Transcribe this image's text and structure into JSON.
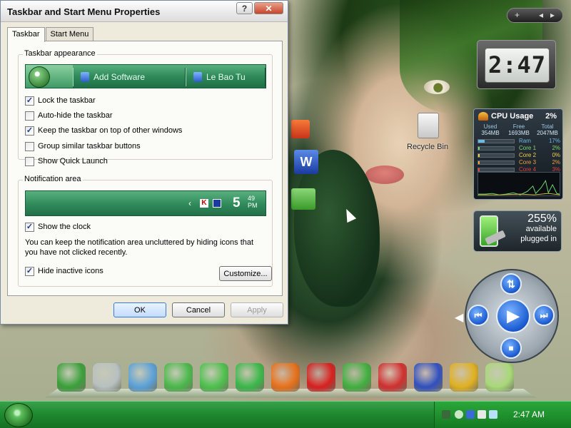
{
  "dialog": {
    "title": "Taskbar and Start Menu Properties",
    "help_label": "?",
    "close_label": "✕",
    "tabs": [
      {
        "label": "Taskbar",
        "active": true
      },
      {
        "label": "Start Menu",
        "active": false
      }
    ],
    "appearance": {
      "group_label": "Taskbar appearance",
      "preview_buttons": [
        "Add Software",
        "Le Bao Tu"
      ],
      "checkboxes": [
        {
          "label": "Lock the taskbar",
          "checked": true
        },
        {
          "label": "Auto-hide the taskbar",
          "checked": false
        },
        {
          "label": "Keep the taskbar on top of other windows",
          "checked": true
        },
        {
          "label": "Group similar taskbar buttons",
          "checked": false
        },
        {
          "label": "Show Quick Launch",
          "checked": false
        }
      ]
    },
    "notification": {
      "group_label": "Notification area",
      "preview_chevron": "‹",
      "preview_k": "K",
      "preview_time": "5",
      "preview_min": "49",
      "preview_ampm": "PM",
      "show_clock": {
        "label": "Show the clock",
        "checked": true
      },
      "description": "You can keep the notification area uncluttered by hiding icons that you have not clicked recently.",
      "hide_inactive": {
        "label": "Hide inactive icons",
        "checked": true
      },
      "customize_label": "Customize..."
    },
    "buttons": {
      "ok": "OK",
      "cancel": "Cancel",
      "apply": "Apply"
    }
  },
  "desktop": {
    "recycle_bin_label": "Recycle Bin"
  },
  "sidebar": {
    "controls": {
      "add": "+",
      "prev": "◂",
      "next": "▸"
    },
    "clock": "2:47",
    "cpu": {
      "title": "CPU Usage",
      "total_pct": "2%",
      "headers": [
        "Used",
        "Free",
        "Total"
      ],
      "values": [
        "354MB",
        "1693MB",
        "2047MB"
      ],
      "rows": [
        {
          "name": "Ram",
          "value": "17%",
          "level": 0.17,
          "color": "#6fb8e0"
        },
        {
          "name": "Core 1",
          "value": "2%",
          "level": 0.02,
          "color": "#7ed86f"
        },
        {
          "name": "Core 2",
          "value": "0%",
          "level": 0.0,
          "color": "#f0d050"
        },
        {
          "name": "Core 3",
          "value": "2%",
          "level": 0.02,
          "color": "#f0a040"
        },
        {
          "name": "Core 4",
          "value": "3%",
          "level": 0.03,
          "color": "#e04040"
        }
      ]
    },
    "battery": {
      "percent": "255%",
      "line1": "available",
      "line2": "plugged in"
    }
  },
  "media_controls": {
    "prev": "⏮",
    "play": "▶",
    "next": "⏭",
    "stop": "■",
    "up": "⇅"
  },
  "dock": [
    {
      "name": "computer-icon",
      "color": "#3aa03a"
    },
    {
      "name": "recycle-bin-icon",
      "color": "#b8c0c0"
    },
    {
      "name": "control-panel-icon",
      "color": "#5aa0d8"
    },
    {
      "name": "media-player-icon",
      "color": "#4ab84a"
    },
    {
      "name": "apple-icon",
      "color": "#4cc04c"
    },
    {
      "name": "internet-explorer-icon",
      "color": "#3ab84a"
    },
    {
      "name": "firefox-icon",
      "color": "#e8701a"
    },
    {
      "name": "opera-icon",
      "color": "#d82020"
    },
    {
      "name": "skype-icon",
      "color": "#40b040"
    },
    {
      "name": "acrobat-icon",
      "color": "#d03030"
    },
    {
      "name": "feather-icon",
      "color": "#3050c0"
    },
    {
      "name": "tools-icon",
      "color": "#e0b020"
    },
    {
      "name": "folder-icon",
      "color": "#a8d878"
    }
  ],
  "taskbar": {
    "time": "2:47 AM"
  }
}
